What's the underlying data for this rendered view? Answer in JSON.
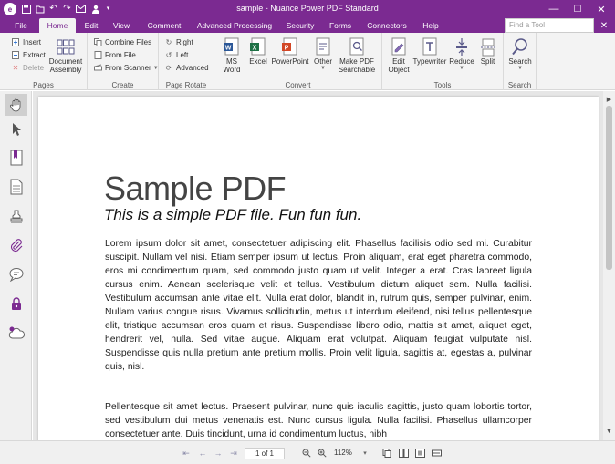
{
  "window": {
    "title": "sample - Nuance Power PDF Standard",
    "logo_text": "e",
    "minimize": "—",
    "maximize": "☐",
    "close": "✕"
  },
  "quick_access": [
    "save-icon",
    "open-icon",
    "undo-icon",
    "redo-icon",
    "mail-icon",
    "user-icon",
    "customize-icon"
  ],
  "menu_tabs": [
    {
      "label": "File",
      "active": false
    },
    {
      "label": "Home",
      "active": true
    },
    {
      "label": "Edit",
      "active": false
    },
    {
      "label": "View",
      "active": false
    },
    {
      "label": "Comment",
      "active": false
    },
    {
      "label": "Advanced Processing",
      "active": false
    },
    {
      "label": "Security",
      "active": false
    },
    {
      "label": "Forms",
      "active": false
    },
    {
      "label": "Connectors",
      "active": false
    },
    {
      "label": "Help",
      "active": false
    }
  ],
  "find_tool": {
    "placeholder": "Find a Tool",
    "close": "✕"
  },
  "ribbon": {
    "pages": {
      "label": "Pages",
      "insert": "Insert",
      "extract": "Extract",
      "delete": "Delete",
      "document_assembly": "Document\nAssembly"
    },
    "create": {
      "label": "Create",
      "combine_files": "Combine Files",
      "from_file": "From File",
      "from_scanner": "From Scanner"
    },
    "page_rotate": {
      "label": "Page Rotate",
      "right": "Right",
      "left": "Left",
      "advanced": "Advanced"
    },
    "convert": {
      "label": "Convert",
      "ms_word": "MS\nWord",
      "excel": "Excel",
      "powerpoint": "PowerPoint",
      "other": "Other",
      "make_pdf_searchable": "Make PDF\nSearchable"
    },
    "tools": {
      "label": "Tools",
      "edit_object": "Edit\nObject",
      "typewriter": "Typewriter",
      "reduce": "Reduce",
      "split": "Split"
    },
    "search": {
      "label": "Search",
      "search": "Search"
    }
  },
  "left_toolbar": [
    "hand-tool-icon",
    "select-arrow-icon",
    "bookmark-icon",
    "pages-icon",
    "stamp-icon",
    "attachment-icon",
    "comment-icon",
    "lock-icon",
    "cloud-icon"
  ],
  "document": {
    "title": "Sample PDF",
    "subtitle": "This is a simple PDF file. Fun fun fun.",
    "paragraph1": "Lorem ipsum dolor sit amet, consectetuer adipiscing elit. Phasellus facilisis odio sed mi. Curabitur suscipit. Nullam vel nisi. Etiam semper ipsum ut lectus. Proin aliquam, erat eget pharetra commodo, eros mi condimentum quam, sed commodo justo quam ut velit. Integer a erat. Cras laoreet ligula cursus enim. Aenean scelerisque velit et tellus. Vestibulum dictum aliquet sem. Nulla facilisi. Vestibulum accumsan ante vitae elit. Nulla erat dolor, blandit in, rutrum quis, semper pulvinar, enim. Nullam varius congue risus. Vivamus sollicitudin, metus ut interdum eleifend, nisi tellus pellentesque elit, tristique accumsan eros quam et risus. Suspendisse libero odio, mattis sit amet, aliquet eget, hendrerit vel, nulla. Sed vitae augue. Aliquam erat volutpat. Aliquam feugiat vulputate nisl. Suspendisse quis nulla pretium ante pretium mollis. Proin velit ligula, sagittis at, egestas a, pulvinar quis, nisl.",
    "paragraph2": "Pellentesque sit amet lectus. Praesent pulvinar, nunc quis iaculis sagittis, justo quam lobortis tortor, sed vestibulum dui metus venenatis est. Nunc cursus ligula. Nulla facilisi. Phasellus ullamcorper consectetuer ante. Duis tincidunt, urna id condimentum luctus, nibh"
  },
  "status_bar": {
    "page_indicator": "1 of 1",
    "zoom": "112%"
  },
  "colors": {
    "brand": "#7b2a91",
    "ribbon_bg": "#f3f3f3",
    "doc_bg": "#e6e6e6"
  }
}
